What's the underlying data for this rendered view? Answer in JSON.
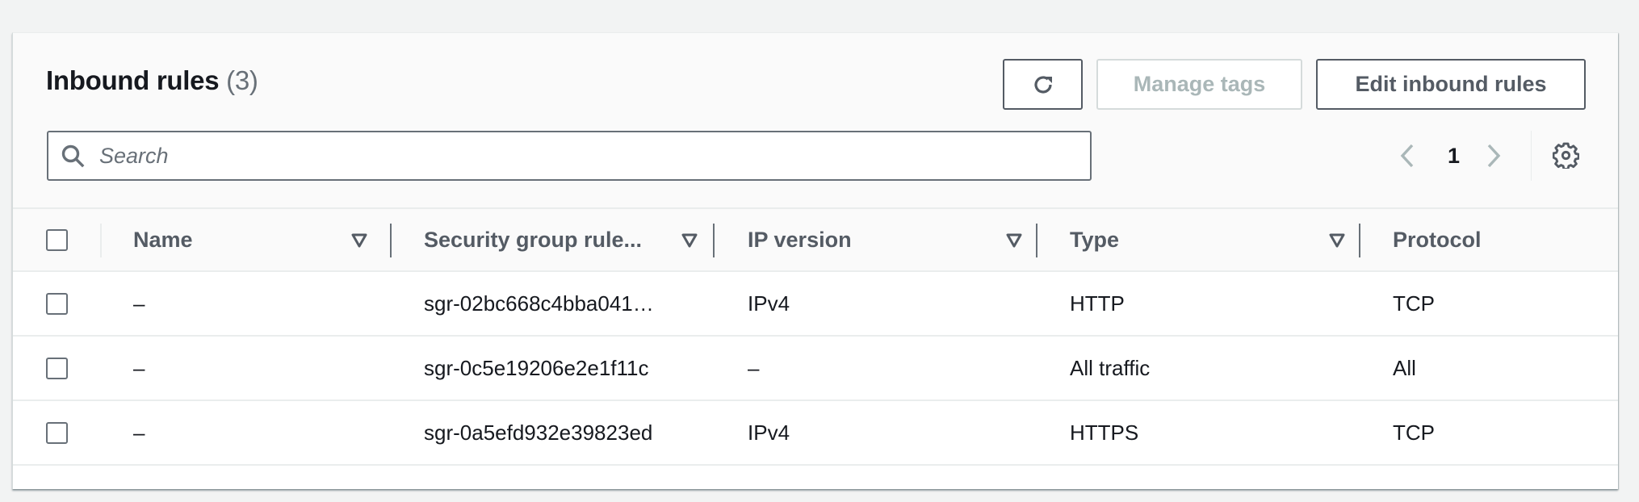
{
  "panel": {
    "title": "Inbound rules",
    "count": "(3)"
  },
  "toolbar": {
    "refresh_icon": "refresh-icon",
    "manage_tags_label": "Manage tags",
    "manage_tags_disabled": true,
    "edit_label": "Edit inbound rules"
  },
  "search": {
    "placeholder": "Search",
    "value": ""
  },
  "pagination": {
    "current_page": "1",
    "prev_disabled": true,
    "next_disabled": true
  },
  "table": {
    "columns": [
      {
        "label": "Name",
        "filterable": true
      },
      {
        "label": "Security group rule...",
        "filterable": true
      },
      {
        "label": "IP version",
        "filterable": true
      },
      {
        "label": "Type",
        "filterable": true
      },
      {
        "label": "Protocol",
        "filterable": false
      }
    ],
    "rows": [
      {
        "name": "–",
        "sgr_id": "sgr-02bc668c4bba041…",
        "ip_version": "IPv4",
        "type": "HTTP",
        "protocol": "TCP",
        "selected": false
      },
      {
        "name": "–",
        "sgr_id": "sgr-0c5e19206e2e1f11c",
        "ip_version": "–",
        "type": "All traffic",
        "protocol": "All",
        "selected": false
      },
      {
        "name": "–",
        "sgr_id": "sgr-0a5efd932e39823ed",
        "ip_version": "IPv4",
        "type": "HTTPS",
        "protocol": "TCP",
        "selected": false
      }
    ]
  },
  "colors": {
    "page_bg": "#f2f3f3",
    "text_primary": "#16191f",
    "text_secondary": "#545b64",
    "disabled": "#aab7b8",
    "border": "#687078"
  }
}
